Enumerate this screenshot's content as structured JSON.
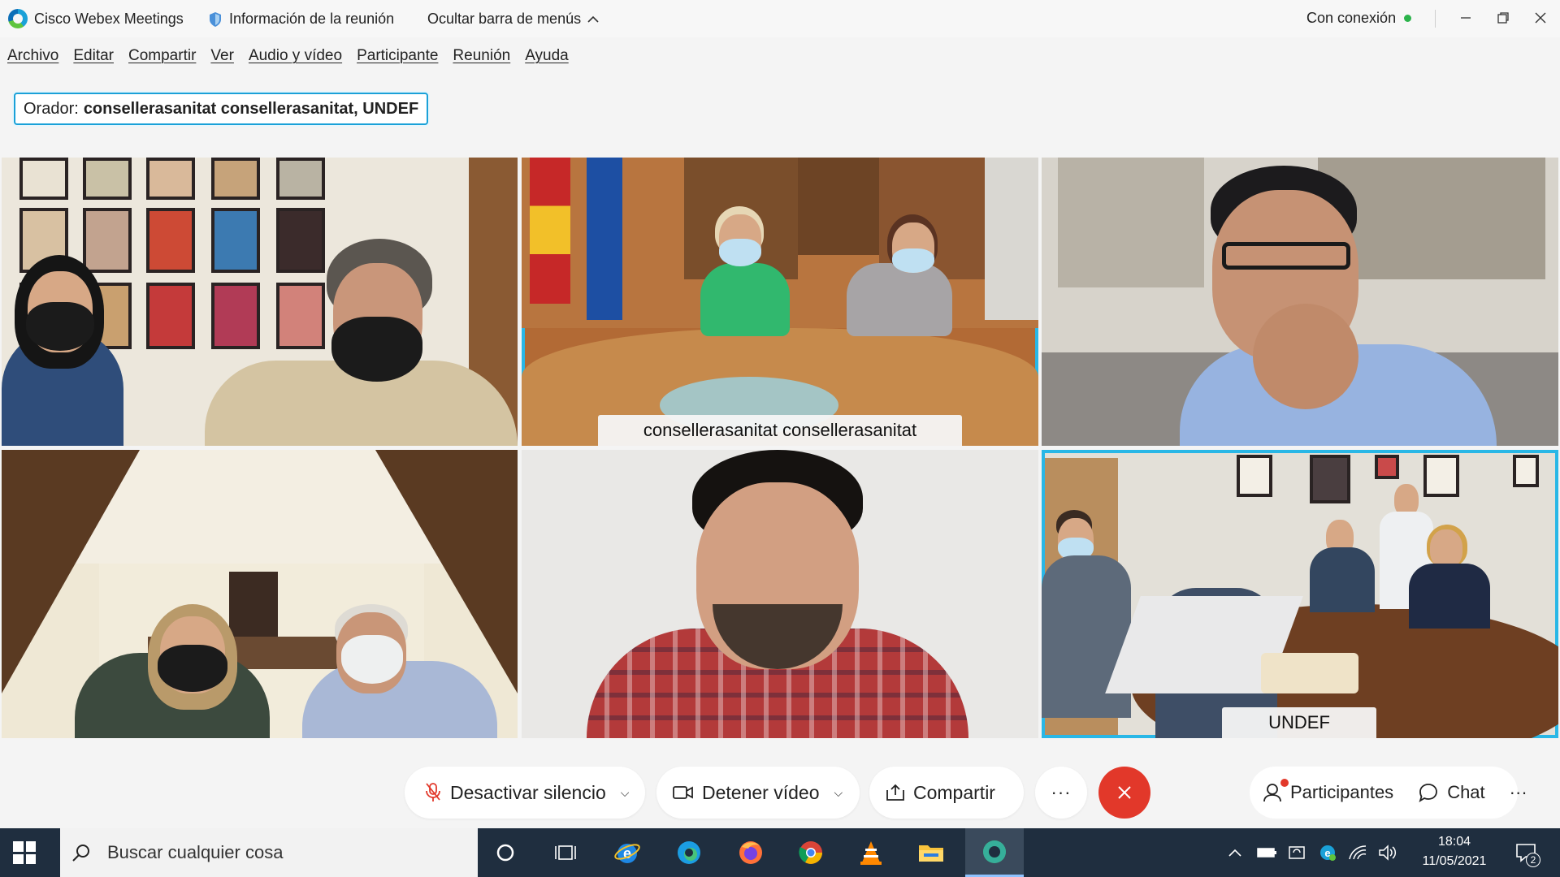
{
  "window": {
    "app_name": "Cisco Webex Meetings",
    "meeting_info_label": "Información de la reunión",
    "hide_menu_label": "Ocultar barra de menús",
    "status_label": "Con conexión",
    "status_color": "#2bb34b"
  },
  "menu": {
    "items": [
      {
        "label": "Archivo"
      },
      {
        "label": "Editar"
      },
      {
        "label": "Compartir"
      },
      {
        "label": "Ver"
      },
      {
        "label": "Audio y vídeo"
      },
      {
        "label": "Participante"
      },
      {
        "label": "Reunión"
      },
      {
        "label": "Ayuda"
      }
    ]
  },
  "speaker": {
    "prefix": "Orador:",
    "names": "consellerasanitat consellerasanitat, UNDEF"
  },
  "videos": [
    {
      "label": ""
    },
    {
      "label": "consellerasanitat consellerasanitat",
      "active": true
    },
    {
      "label": ""
    },
    {
      "label": ""
    },
    {
      "label": ""
    },
    {
      "label": "UNDEF",
      "active": true
    }
  ],
  "controls": {
    "mute_label": "Desactivar silencio",
    "video_label": "Detener vídeo",
    "share_label": "Compartir",
    "more_label": "···",
    "participants_label": "Participantes",
    "chat_label": "Chat",
    "right_more_label": "···",
    "end_color": "#e2382a",
    "accent_color": "#29b7e6"
  },
  "taskbar": {
    "search_placeholder": "Buscar cualquier cosa",
    "time": "18:04",
    "date": "11/05/2021",
    "notification_count": "2",
    "icons": [
      "cortana-icon",
      "task-view-icon",
      "ie-icon",
      "edge-icon",
      "firefox-icon",
      "chrome-icon",
      "vlc-icon",
      "explorer-icon",
      "webex-icon"
    ]
  }
}
